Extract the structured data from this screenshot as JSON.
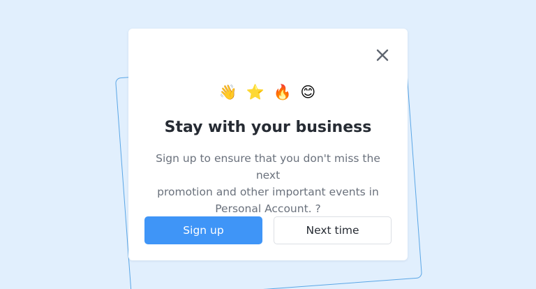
{
  "modal": {
    "emojis": [
      "👋",
      "⭐",
      "🔥",
      "😊"
    ],
    "emoji_names": [
      "waving-hand-emoji",
      "star-emoji",
      "fire-emoji",
      "smiling-face-emoji"
    ],
    "title": "Stay with your business",
    "description_lines": [
      "Sign up to ensure that you don't miss the next",
      "promotion and other important events in",
      "Personal Account. ?"
    ],
    "primary_button": "Sign up",
    "secondary_button": "Next time",
    "close_icon": "close-icon"
  },
  "colors": {
    "background": "#e1effd",
    "accent": "#3f95f7",
    "back_card_border": "#5aa6e6",
    "title": "#262b33",
    "body_text": "#6a717c"
  }
}
